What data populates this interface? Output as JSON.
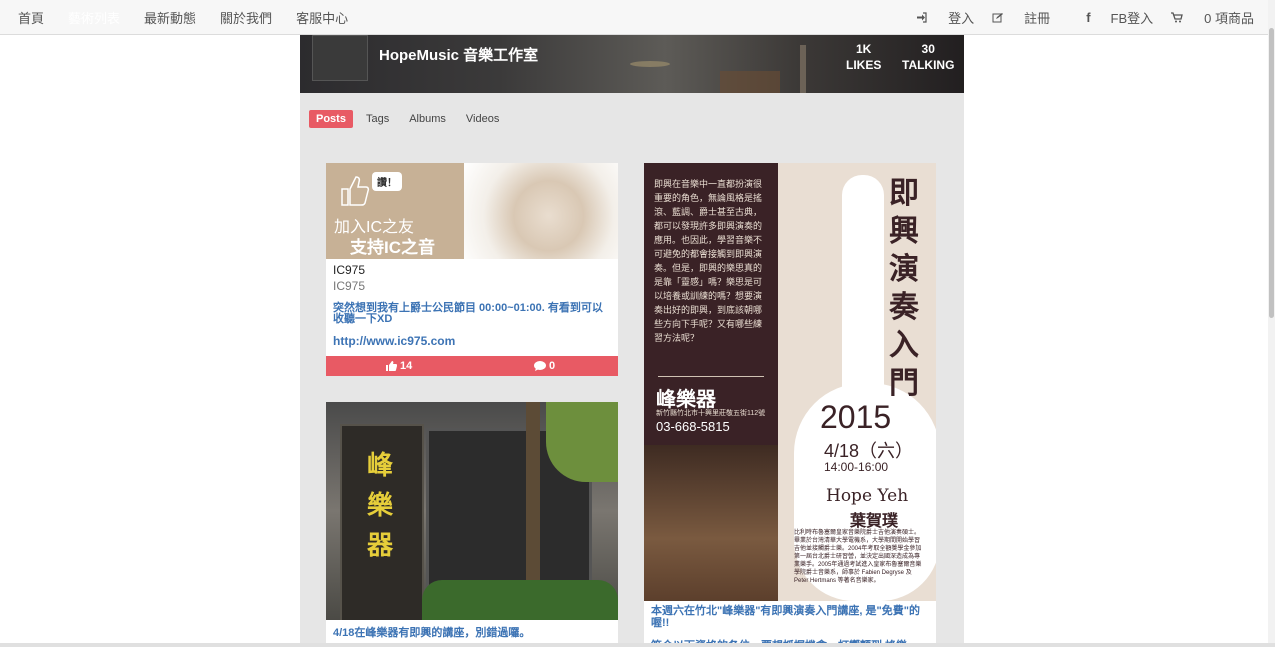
{
  "nav": {
    "left": [
      "首頁",
      "藝術列表",
      "最新動態",
      "關於我們",
      "客服中心"
    ],
    "active_index": 1,
    "login": "登入",
    "register": "註冊",
    "fb_login": "FB登入",
    "cart": "0 項商品"
  },
  "page_header": {
    "name": "HopeMusic 音樂工作室",
    "likes_value": "1K",
    "likes_label": "LIKES",
    "talking_value": "30",
    "talking_label": "TALKING"
  },
  "tabs": [
    "Posts",
    "Tags",
    "Albums",
    "Videos"
  ],
  "posts": [
    {
      "banner_bubble": "讚！",
      "banner_line1": "加入IC之友",
      "banner_line2": "支持IC之音",
      "name": "IC975",
      "sub": "IC975",
      "message": "突然想到我有上爵士公民節目 00:00~01:00. 有看到可以收聽一下XD",
      "link": "http://www.ic975.com",
      "likes": "14",
      "comments": "0"
    },
    {
      "sign_text": "峰樂器",
      "caption": "4/18在峰樂器有即興的講座，別錯過囉。"
    },
    {
      "intro": "即興在音樂中一直都扮演很重要的角色，無論風格是搖滾、藍調、爵士甚至古典，都可以發現許多即興演奏的應用。也因此，學習音樂不可避免的都會接觸到即興演奏。但是，即興的樂思真的是靠「靈感」嗎？樂思是可以培養或訓練的嗎？想要演奏出好的即興，到底該朝哪些方向下手呢？又有哪些練習方法呢？",
      "brand": "峰樂器",
      "address": "新竹縣竹北市十興里莊敬五街112號",
      "phone": "03-668-5815",
      "title": "即興演奏入門",
      "year": "2015",
      "date": "4/18（六）",
      "time": "14:00-16:00",
      "teacher_en": "Hope Yeh",
      "teacher_zh": "葉賀璞",
      "bio": "比利時布魯塞爾皇家音樂院爵士吉他演奏碩士。畢業於台灣清華大學電機系，大學期間開始學習吉他並接觸爵士樂。2004年考取全額獎學金參加第一屆台北爵士研習營，並決定出國深造成為專業樂手。2005年通過考試進入皇家布魯塞爾音樂學院爵士音樂系，師事於 Fabien Degryse 及 Peter Hertmans 等著名音樂家。",
      "caption": "本週六在竹北\"峰樂器\"有即興演奏入門講座, 是\"免費\"的喔!!",
      "caption2": "符合以下資格的各位，要想抓握機會，打響顫到 峰樂"
    }
  ],
  "colors": {
    "accent": "#e85a64",
    "link": "#3c73b4",
    "poster_dark": "#3a2226"
  }
}
